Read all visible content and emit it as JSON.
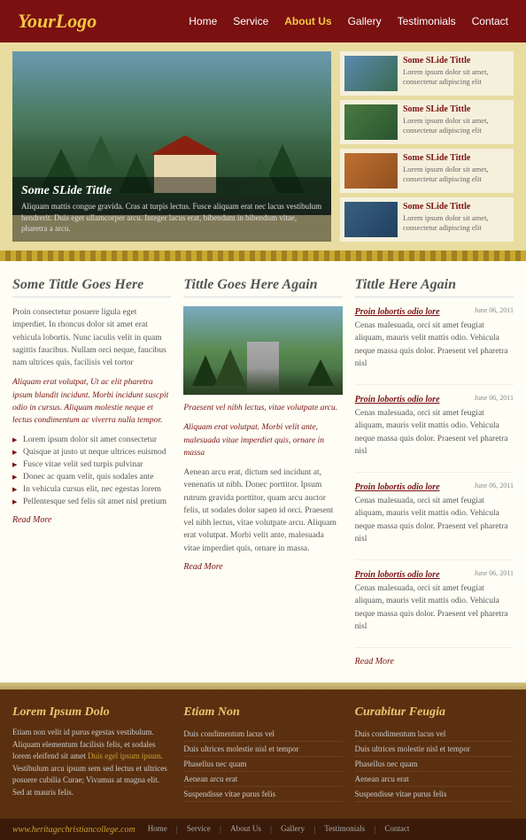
{
  "header": {
    "logo": "YourLogo",
    "nav": [
      {
        "label": "Home",
        "active": false
      },
      {
        "label": "Service",
        "active": false
      },
      {
        "label": "About Us",
        "active": true
      },
      {
        "label": "Gallery",
        "active": false
      },
      {
        "label": "Testimonials",
        "active": false
      },
      {
        "label": "Contact",
        "active": false
      }
    ]
  },
  "hero": {
    "title": "Some SLide Tittle",
    "caption": "Aliquam mattis congue gravida. Cras at turpis lectus. Fusce aliquam erat nec lacus vestibulum hendrerit. Duis eget ullamcorper arcu. Integer lacus erat, bibendum in bibendum vitae, pharetra a arcu.",
    "thumbs": [
      {
        "title": "Some SLide Tittle",
        "text": "Lorem ipsum dolor sit amet, consectetur adipiscing elit"
      },
      {
        "title": "Some SLide Tittle",
        "text": "Lorem ipsum dolor sit amet, consectetur adipiscing elit"
      },
      {
        "title": "Some SLide Tittle",
        "text": "Lorem ipsum dolor sit amet, consectetur adipiscing elit"
      },
      {
        "title": "Some SLide Tittle",
        "text": "Lorem ipsum dolor sit amet, consectetur adipiscing elit"
      }
    ]
  },
  "main": {
    "col1": {
      "title": "Some Tittle Goes Here",
      "para1": "Proin consectetur posuere ligula eget imperdiet. In rhoncus dolor sit amet erat vehicula lobortis. Nunc iaculis velit in quam sagittis faucibus. Nullam orci neque, faucibus nam ultrices quis, facilisis vel tortor",
      "para2": "Aliquam erat volutpat, Ut ac elit pharetra ipsum blandit incidunt. Morbi incidunt suscpit odio in cursus. Aliquam molestie neque et lectus condimentum ac viverra nulla tempor.",
      "bullets": [
        "Lorem ipsum dolor sit amet consectetur",
        "Quisque at justo ut neque ultrices euismod",
        "Fusce vitae velit sed turpis pulvinar",
        "Donec ac quam velit, quis sodales ante",
        "In vehicula cursus elit, nec egestas lorem",
        "Pellentesque sed felis sit amet nisl pretium"
      ],
      "read_more": "Read More"
    },
    "col2": {
      "title": "Tittle Goes Here Again",
      "caption1": "Praesent vel nibh lectus, vitae volutpate arcu.",
      "caption2": "Aliquam erat volutpat. Morbi velit ante, malesuada vitae imperdiet quis, ornare in massa",
      "para": "Aenean arcu erat, dictum sed incidunt at, venenatis ut nibh. Donec porttitor. Ipsum rutrum gravida porttitor, quam arcu auctor felis, ut sodales dolor sapen id orci. Praesent vel nibh lectus, vitae volutpate arcu. Aliquam erat volutpat. Morbi velit ante, malesuada vitae imperdiet quis, ornare in massa.",
      "read_more": "Read More"
    },
    "col3": {
      "title": "Tittle Here Again",
      "posts": [
        {
          "title": "Proin lobortis odio lore",
          "date": "June 06, 2011",
          "text": "Cenas malesuada, orci sit amet feugiat aliquam, mauris velit mattis odio. Vehicula neque massa quis dolor. Praesent vel pharetra nisl"
        },
        {
          "title": "Proin lobortis odio lore",
          "date": "June 06, 2011",
          "text": "Cenas malesuada, orci sit amet feugiat aliquam, mauris velit mattis odio. Vehicula neque massa quis dolor. Praesent vel pharetra nisl"
        },
        {
          "title": "Proin lobortis odio lore",
          "date": "June 06, 2011",
          "text": "Cenas malesuada, orci sit amet feugiat aliquam, mauris velit mattis odio. Vehicula neque massa quis dolor. Praesent vel pharetra nisl"
        },
        {
          "title": "Proin lobortis odio lore",
          "date": "June 06, 2011",
          "text": "Cenas malesuada, orci sit amet feugiat aliquam, mauris velit mattis odio. Vehicula neque massa quis dolor. Praesent vel pharetra nisl"
        }
      ],
      "read_more": "Read More"
    }
  },
  "footer_top": {
    "col1": {
      "title": "Lorem Ipsum Dolo",
      "text": "Etiam non velit id purus egestas vestibulum. Aliquam elementum facilisis felis, at sodales lorem eleifend sit amet. Duis eget ipsum ipsum. Vestibulum arcu ipsum sem sed lectus et ultrices posuere cubilia Curae; Vivamus at magna elit. Sed at mauris felis.",
      "link": "Duis egel ipsum ipsum"
    },
    "col2": {
      "title": "Etiam Non",
      "links": [
        "Duis condimentum lacus vel",
        "Duis ultrices molestie nisl et tempor",
        "Phasellus nec quam",
        "Aenean arcu erat",
        "Suspendisse vitae purus felis"
      ]
    },
    "col3": {
      "title": "Curabitur Feugia",
      "links": [
        "Duis condimentum lacus vel",
        "Duis ultrices molestie nisl et tempor",
        "Phasellus nec quam",
        "Aenean arcu erat",
        "Suspendisse vitae purus felis"
      ]
    }
  },
  "footer_bottom": {
    "url": "www.heritagechristiancollege.com",
    "nav": [
      {
        "label": "Home"
      },
      {
        "label": "Service"
      },
      {
        "label": "About Us"
      },
      {
        "label": "Gallery"
      },
      {
        "label": "Testimonials"
      },
      {
        "label": "Contact"
      }
    ]
  }
}
